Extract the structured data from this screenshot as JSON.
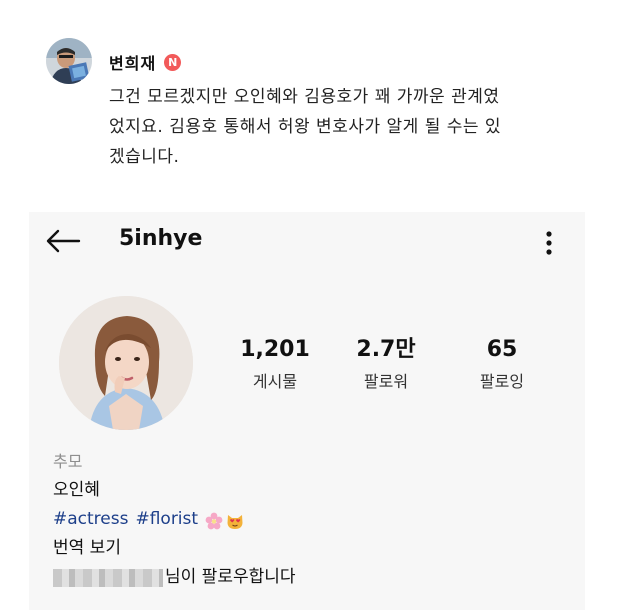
{
  "comment": {
    "author": "변희재",
    "badge": "N",
    "lines": [
      "그건 모르겠지만 오인혜와 김용호가 꽤 가까운 관계였",
      "었지요. 김용호 통해서 허왕 변호사가 알게 될 수는 있",
      "겠습니다."
    ]
  },
  "profile": {
    "username": "5inhye",
    "stats": [
      {
        "value": "1,201",
        "label": "게시물"
      },
      {
        "value": "2.7만",
        "label": "팔로워"
      },
      {
        "value": "65",
        "label": "팔로잉"
      }
    ],
    "category": "추모",
    "display_name": "오인혜",
    "hashtags": [
      "#actress",
      "#florist"
    ],
    "emojis": [
      "cherry-blossom-icon",
      "heart-eyes-cat-icon"
    ],
    "translate_label": "번역 보기",
    "followed_by_suffix": "님이 팔로우합니다"
  },
  "colors": {
    "card_bg": "#f7f7f7",
    "hashtag": "#1d3f8a",
    "category": "#8e8e8e",
    "badge_bg": "#f25a5a"
  }
}
